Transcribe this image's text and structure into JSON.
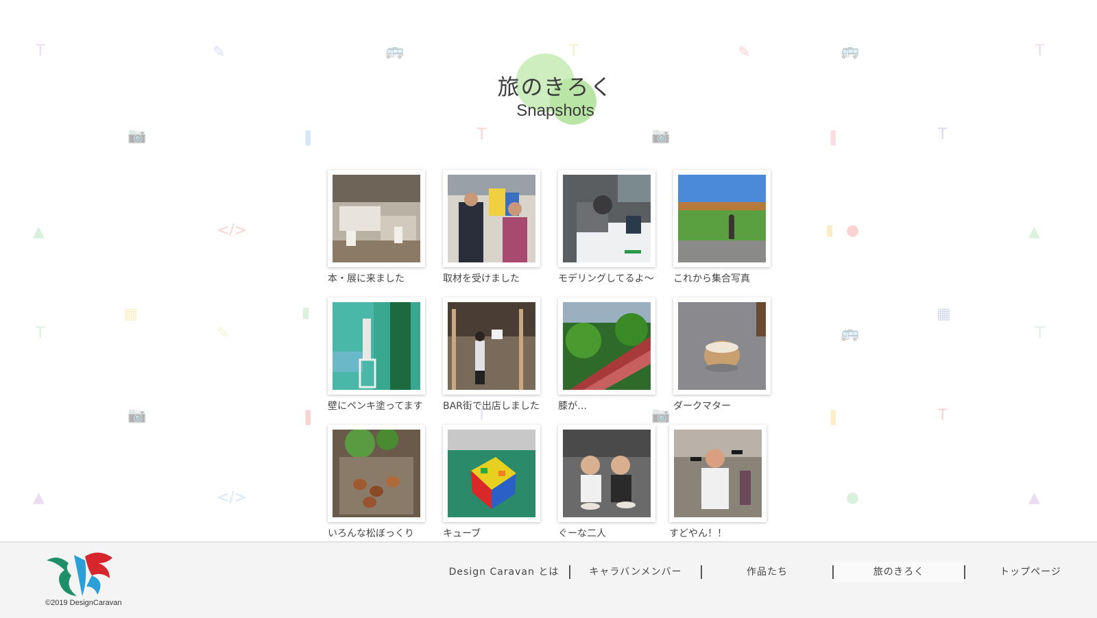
{
  "header": {
    "title_jp": "旅のきろく",
    "title_en": "Snapshots"
  },
  "gallery": {
    "items": [
      {
        "caption": "本・展に来ました",
        "icon": "exhibition-photo"
      },
      {
        "caption": "取材を受けました",
        "icon": "interview-photo"
      },
      {
        "caption": "モデリングしてるよ～",
        "icon": "modeling-photo"
      },
      {
        "caption": "これから集合写真",
        "icon": "field-photo"
      },
      {
        "caption": "壁にペンキ塗ってます",
        "icon": "painting-photo"
      },
      {
        "caption": "BAR街で出店しました",
        "icon": "bar-photo"
      },
      {
        "caption": "膝が…",
        "icon": "stairs-photo"
      },
      {
        "caption": "ダークマター",
        "icon": "dessert-photo"
      },
      {
        "caption": "いろんな松ぼっくり",
        "icon": "pinecone-photo"
      },
      {
        "caption": "キューブ",
        "icon": "cube-photo"
      },
      {
        "caption": "ぐーな二人",
        "icon": "two-people-photo"
      },
      {
        "caption": "すどやん！！",
        "icon": "sudoyan-photo"
      }
    ]
  },
  "footer": {
    "copyright": "©2019 DesignCaravan",
    "nav": [
      {
        "label": "Design Caravan とは"
      },
      {
        "label": "キャラバンメンバー"
      },
      {
        "label": "作品たち"
      },
      {
        "label": "旅のきろく",
        "active": true
      },
      {
        "label": "トップページ"
      }
    ]
  },
  "colors": {
    "accent_green": "#b9e6a6",
    "logo_green": "#1f8f6a",
    "logo_red": "#d8262f",
    "logo_blue": "#2a9fd8"
  }
}
